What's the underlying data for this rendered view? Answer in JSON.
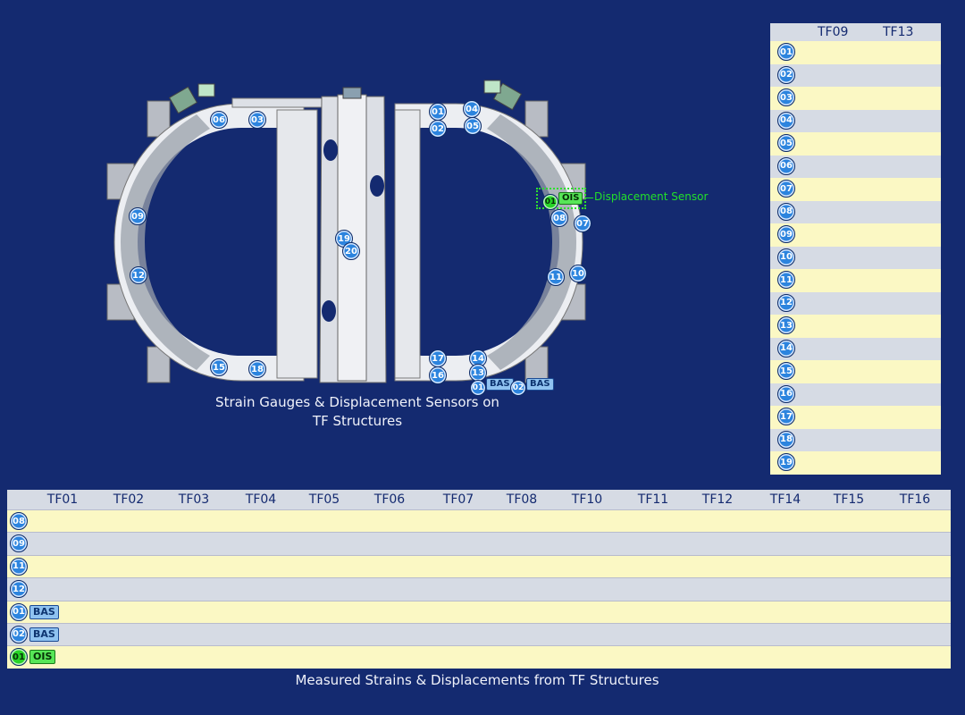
{
  "diagram": {
    "caption_line1": "Strain Gauges & Displacement Sensors  on",
    "caption_line2": "TF Structures",
    "displacement_label": "Displacement Sensor",
    "markers": [
      "06",
      "03",
      "09",
      "12",
      "15",
      "18",
      "19",
      "20",
      "01",
      "02",
      "04",
      "05",
      "07",
      "08",
      "10",
      "11",
      "17",
      "16",
      "14",
      "13",
      "01",
      "02",
      "01"
    ],
    "bas_tag": "BAS",
    "ois_tag": "OIS"
  },
  "right_panel": {
    "columns": [
      "TF09",
      "TF13"
    ],
    "rows": [
      "01",
      "02",
      "03",
      "04",
      "05",
      "06",
      "07",
      "08",
      "09",
      "10",
      "11",
      "12",
      "13",
      "14",
      "15",
      "16",
      "17",
      "18",
      "19"
    ]
  },
  "bottom_table": {
    "columns": [
      "TF01",
      "TF02",
      "TF03",
      "TF04",
      "TF05",
      "TF06",
      "TF07",
      "TF08",
      "TF10",
      "TF11",
      "TF12",
      "TF14",
      "TF15",
      "TF16"
    ],
    "rows": [
      {
        "id": "08",
        "tag": ""
      },
      {
        "id": "09",
        "tag": ""
      },
      {
        "id": "11",
        "tag": ""
      },
      {
        "id": "12",
        "tag": ""
      },
      {
        "id": "01",
        "tag": "BAS"
      },
      {
        "id": "02",
        "tag": "BAS"
      },
      {
        "id": "01",
        "tag": "OIS"
      }
    ],
    "caption": "Measured Strains & Displacements  from TF Structures"
  },
  "colors": {
    "background": "#142a70",
    "badge_blue": "#2c84de",
    "badge_green": "#28d428",
    "row_yellow": "#fbf8c4",
    "row_grey": "#d6dbe4",
    "label_green": "#22e02a"
  }
}
